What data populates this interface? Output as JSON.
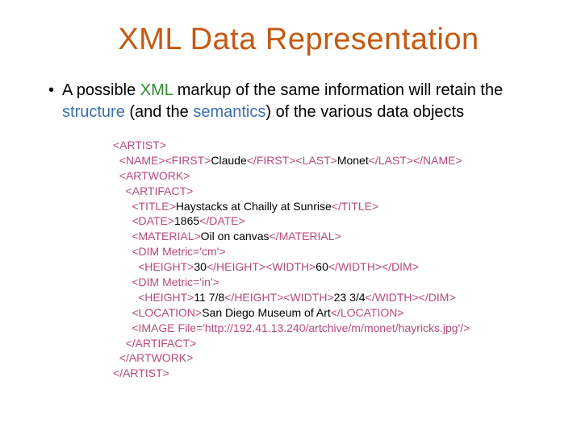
{
  "title": "XML Data Representation",
  "bullet": {
    "prefix": "A possible ",
    "xml": "XML",
    "mid1": " markup of the same information will retain the ",
    "structure": "structure",
    "mid2": " (and the ",
    "semantics": "semantics",
    "suffix": ") of the various data objects"
  },
  "code": {
    "l01a": "<ARTIST>",
    "l02a": "  <NAME><FIRST>",
    "l02b": "Claude",
    "l02c": "</FIRST><LAST>",
    "l02d": "Monet",
    "l02e": "</LAST></NAME>",
    "l03a": "  <ARTWORK>",
    "l04a": "    <ARTIFACT>",
    "l05a": "      <TITLE>",
    "l05b": "Haystacks at Chailly at Sunrise",
    "l05c": "</TITLE>",
    "l06a": "      <DATE>",
    "l06b": "1865",
    "l06c": "</DATE>",
    "l07a": "      <MATERIAL>",
    "l07b": "Oil on canvas",
    "l07c": "</MATERIAL>",
    "l08a": "      <DIM Metric='cm'>",
    "l09a": "        <HEIGHT>",
    "l09b": "30",
    "l09c": "</HEIGHT><WIDTH>",
    "l09d": "60",
    "l09e": "</WIDTH></DIM>",
    "l10a": "      <DIM Metric='in'>",
    "l11a": "        <HEIGHT>",
    "l11b": "11 7/8",
    "l11c": "</HEIGHT><WIDTH>",
    "l11d": "23 3/4",
    "l11e": "</WIDTH></DIM>",
    "l12a": "      <LOCATION>",
    "l12b": "San Diego Museum of Art",
    "l12c": "</LOCATION>",
    "l13a": "      <IMAGE File='http://192.41.13.240/artchive/m/monet/hayricks.jpg'/>",
    "l14a": "    </ARTIFACT>",
    "l15a": "  </ARTWORK>",
    "l16a": "</ARTIST>"
  }
}
